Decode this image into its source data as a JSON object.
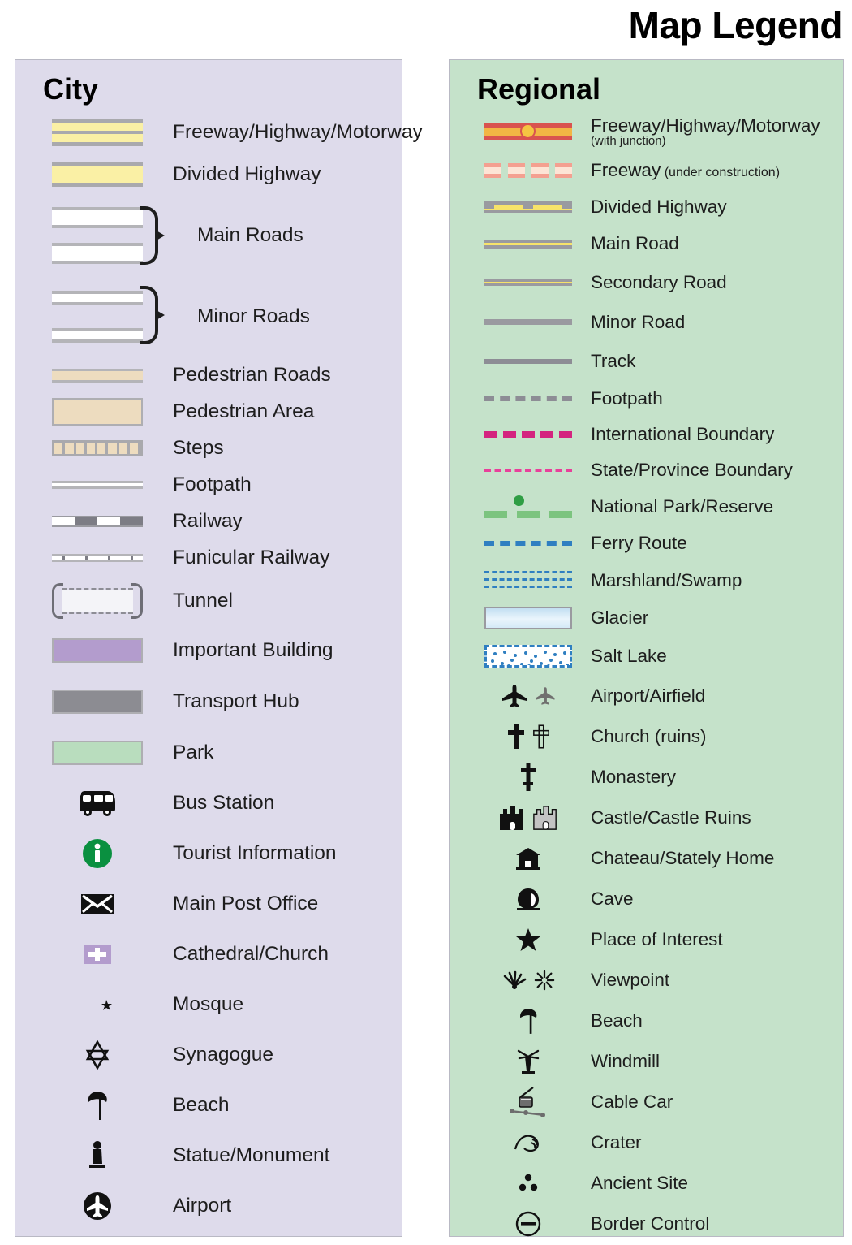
{
  "title": "Map Legend",
  "city": {
    "heading": "City",
    "items": [
      {
        "label": "Freeway/Highway/Motorway",
        "symbol": "city-freeway"
      },
      {
        "label": "Divided Highway",
        "symbol": "city-divided"
      },
      {
        "label": "Main Roads",
        "symbol": "city-main-group"
      },
      {
        "label": "Minor Roads",
        "symbol": "city-minor-group"
      },
      {
        "label": "Pedestrian Roads",
        "symbol": "city-pedestrian-road"
      },
      {
        "label": "Pedestrian Area",
        "symbol": "city-pedestrian-area"
      },
      {
        "label": "Steps",
        "symbol": "city-steps"
      },
      {
        "label": "Footpath",
        "symbol": "city-footpath"
      },
      {
        "label": "Railway",
        "symbol": "city-railway"
      },
      {
        "label": "Funicular Railway",
        "symbol": "city-funicular-railway"
      },
      {
        "label": "Tunnel",
        "symbol": "city-tunnel"
      },
      {
        "label": "Important Building",
        "symbol": "important-building-swatch"
      },
      {
        "label": "Transport Hub",
        "symbol": "transport-hub-swatch"
      },
      {
        "label": "Park",
        "symbol": "park-swatch"
      },
      {
        "label": "Bus Station",
        "symbol": "bus-icon"
      },
      {
        "label": "Tourist Information",
        "symbol": "information-icon"
      },
      {
        "label": "Main Post Office",
        "symbol": "envelope-icon"
      },
      {
        "label": "Cathedral/Church",
        "symbol": "church-cross-icon"
      },
      {
        "label": "Mosque",
        "symbol": "crescent-star-icon"
      },
      {
        "label": "Synagogue",
        "symbol": "star-of-david-icon"
      },
      {
        "label": "Beach",
        "symbol": "beach-umbrella-icon"
      },
      {
        "label": "Statue/Monument",
        "symbol": "statue-icon"
      },
      {
        "label": "Airport",
        "symbol": "airport-icon"
      }
    ]
  },
  "regional": {
    "heading": "Regional",
    "items": [
      {
        "label": "Freeway/Highway/Motorway",
        "sub_block": "(with junction)",
        "symbol": "regional-freeway-junction"
      },
      {
        "label": "Freeway",
        "sub": " (under construction)",
        "symbol": "regional-freeway-under-construction"
      },
      {
        "label": "Divided Highway",
        "symbol": "regional-divided-highway"
      },
      {
        "label": "Main Road",
        "symbol": "regional-main-road"
      },
      {
        "label": "Secondary Road",
        "symbol": "regional-secondary-road"
      },
      {
        "label": "Minor Road",
        "symbol": "regional-minor-road"
      },
      {
        "label": "Track",
        "symbol": "regional-track"
      },
      {
        "label": "Footpath",
        "symbol": "regional-footpath"
      },
      {
        "label": "International Boundary",
        "symbol": "international-boundary-line"
      },
      {
        "label": "State/Province Boundary",
        "symbol": "state-boundary-line"
      },
      {
        "label": "National Park/Reserve",
        "symbol": "national-park-line"
      },
      {
        "label": "Ferry Route",
        "symbol": "ferry-route-line"
      },
      {
        "label": "Marshland/Swamp",
        "symbol": "marshland-pattern"
      },
      {
        "label": "Glacier",
        "symbol": "glacier-swatch"
      },
      {
        "label": "Salt Lake",
        "symbol": "salt-lake-swatch"
      },
      {
        "label": "Airport/Airfield",
        "symbol": "airplane-icon"
      },
      {
        "label": "Church (ruins)",
        "symbol": "church-ruins-icon"
      },
      {
        "label": "Monastery",
        "symbol": "monastery-cross-icon"
      },
      {
        "label": "Castle/Castle Ruins",
        "symbol": "castle-icon"
      },
      {
        "label": "Chateau/Stately Home",
        "symbol": "chateau-icon"
      },
      {
        "label": "Cave",
        "symbol": "cave-icon"
      },
      {
        "label": "Place of Interest",
        "symbol": "star-icon"
      },
      {
        "label": "Viewpoint",
        "symbol": "viewpoint-icon"
      },
      {
        "label": "Beach",
        "symbol": "beach-umbrella-icon"
      },
      {
        "label": "Windmill",
        "symbol": "windmill-icon"
      },
      {
        "label": "Cable Car",
        "symbol": "cable-car-icon"
      },
      {
        "label": "Crater",
        "symbol": "crater-icon"
      },
      {
        "label": "Ancient Site",
        "symbol": "ancient-site-icon"
      },
      {
        "label": "Border Control",
        "symbol": "border-control-icon"
      }
    ]
  },
  "colors": {
    "city_panel": "#dedbeb",
    "regional_panel": "#c5e2ca",
    "road_yellow": "#faf0a5",
    "regional_yellow": "#f7e36a",
    "freeway_red": "#d9534f",
    "freeway_orange": "#f2b544",
    "pedestrian_beige": "#eddcbf",
    "important_building": "#b39ccd",
    "transport_hub": "#8c8c92",
    "park_green": "#b9ddbe",
    "boundary_magenta": "#d4247f",
    "state_boundary_pink": "#e8409a",
    "national_park_green": "#7cc47f",
    "ferry_blue": "#2f7fc1",
    "tourist_info_green": "#0a9040"
  }
}
